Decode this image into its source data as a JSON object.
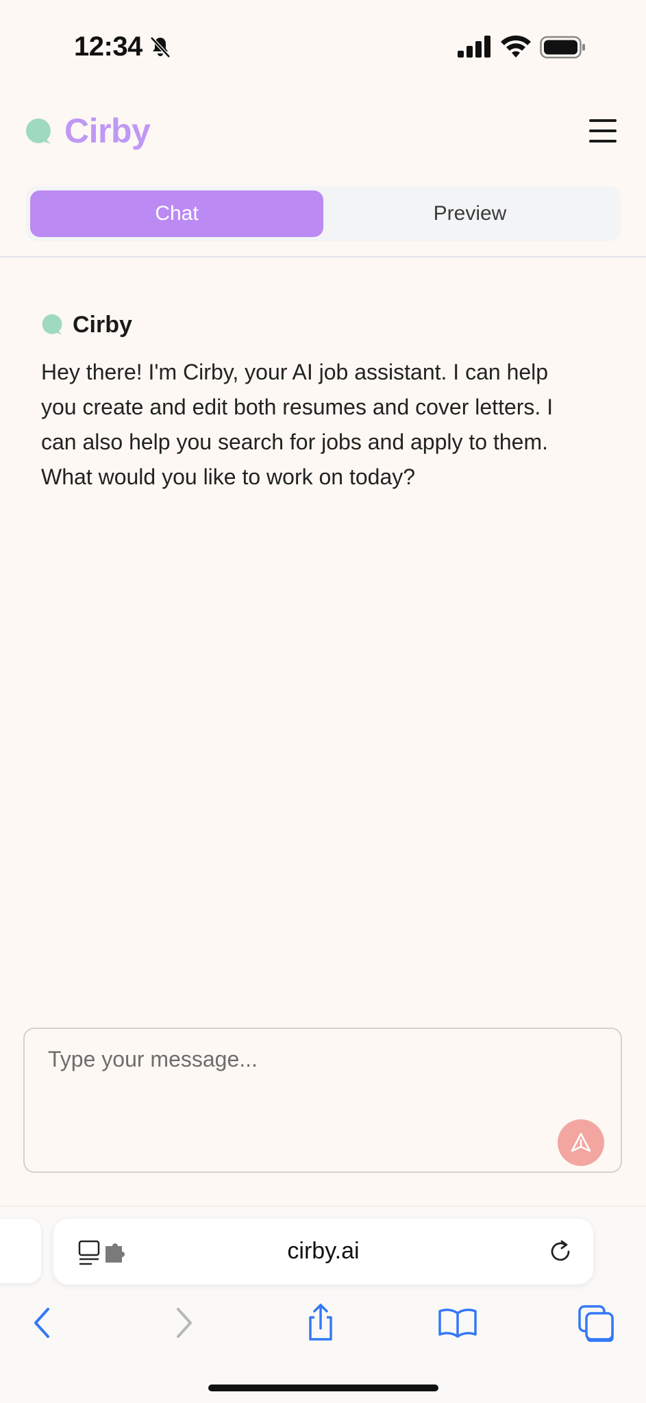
{
  "status_bar": {
    "time": "12:34"
  },
  "header": {
    "brand": "Cirby",
    "menu_icon": "hamburger-menu-icon"
  },
  "tabs": [
    {
      "label": "Chat",
      "active": true
    },
    {
      "label": "Preview",
      "active": false
    }
  ],
  "message": {
    "author": "Cirby",
    "text": "Hey there! I'm Cirby, your AI job assistant. I can help you create and edit both resumes and cover letters. I can also help you search for jobs and apply to them. What would you like to work on today?"
  },
  "composer": {
    "placeholder": "Type your message...",
    "send_icon": "send-icon"
  },
  "browser": {
    "url": "cirby.ai"
  },
  "colors": {
    "brand": "#bf98f5",
    "active_tab": "#bb8af3",
    "logo": "#9fd9bf",
    "send": "#f3a6a0",
    "background": "#fdf8f3",
    "safari_blue": "#3478f6"
  }
}
